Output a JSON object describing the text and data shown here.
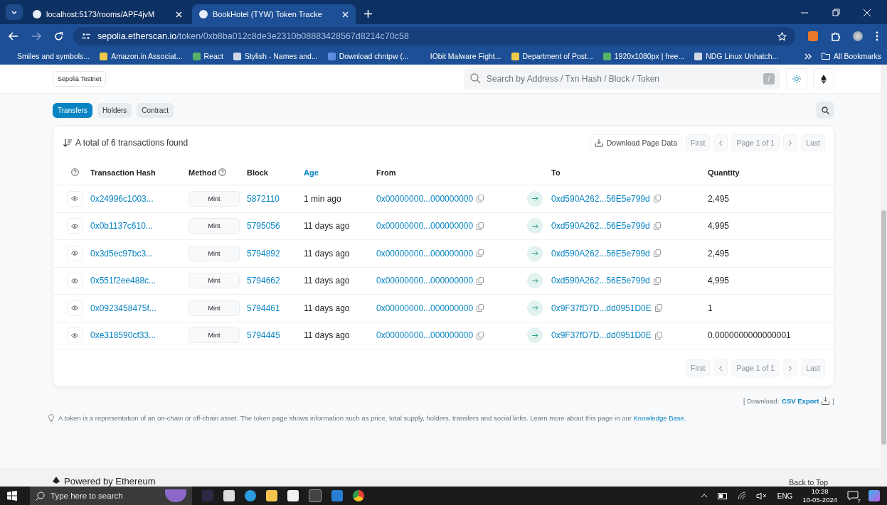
{
  "browser": {
    "tabs": [
      {
        "title": "localhost:5173/rooms/APF4jvM",
        "selected": false
      },
      {
        "title": "BookHotel (TYW) Token Tracke",
        "selected": true
      }
    ],
    "url": {
      "host": "sepolia.etherscan.io",
      "path": "/token/0xb8ba012c8de3e2310b08883428567d8214c70c58"
    },
    "bookmarks": [
      "Smiles and symbols...",
      "Amazon.in Associat...",
      "React",
      "Stylish - Names and...",
      "Download chntpw (...",
      "IObit Malware Fight...",
      "Department of Post...",
      "1920x1080px | free...",
      "NDG Linux Unhatch..."
    ],
    "all_bookmarks": "All Bookmarks"
  },
  "page": {
    "network": "Sepolia Testnet",
    "search_placeholder": "Search by Address / Txn Hash / Block / Token",
    "slash_key": "/",
    "tabs": [
      {
        "label": "Transfers",
        "selected": true
      },
      {
        "label": "Holders",
        "selected": false
      },
      {
        "label": "Contract",
        "selected": false
      }
    ],
    "summary": "A total of 6 transactions found",
    "download": "Download Page Data",
    "pagination": {
      "first": "First",
      "page": "Page 1 of 1",
      "last": "Last"
    },
    "pagination_bottom": {
      "first": "First",
      "page": "Page 1 of 1",
      "last": "Last"
    },
    "columns": [
      {
        "label": "Transaction Hash",
        "help": false,
        "active": false
      },
      {
        "label": "Method",
        "help": true,
        "active": false
      },
      {
        "label": "Block",
        "help": false,
        "active": false
      },
      {
        "label": "Age",
        "help": false,
        "active": true
      },
      {
        "label": "From",
        "help": false,
        "active": false
      },
      {
        "label": "To",
        "help": false,
        "active": false
      },
      {
        "label": "Quantity",
        "help": false,
        "active": false
      }
    ],
    "rows": [
      {
        "hash": "0x24996c1003...",
        "method": "Mint",
        "block": "5872110",
        "age": "1 min ago",
        "from": "0x00000000...000000000",
        "to": "0xd590A262...56E5e799d",
        "quantity": "2,495"
      },
      {
        "hash": "0x0b1137c610...",
        "method": "Mint",
        "block": "5795056",
        "age": "11 days ago",
        "from": "0x00000000...000000000",
        "to": "0xd590A262...56E5e799d",
        "quantity": "4,995"
      },
      {
        "hash": "0x3d5ec97bc3...",
        "method": "Mint",
        "block": "5794892",
        "age": "11 days ago",
        "from": "0x00000000...000000000",
        "to": "0xd590A262...56E5e799d",
        "quantity": "2,495"
      },
      {
        "hash": "0x551f2ee488c...",
        "method": "Mint",
        "block": "5794662",
        "age": "11 days ago",
        "from": "0x00000000...000000000",
        "to": "0xd590A262...56E5e799d",
        "quantity": "4,995"
      },
      {
        "hash": "0x0923458475f...",
        "method": "Mint",
        "block": "5794461",
        "age": "11 days ago",
        "from": "0x00000000...000000000",
        "to": "0x9F37fD7D...dd0951D0E",
        "quantity": "1"
      },
      {
        "hash": "0xe318590cf33...",
        "method": "Mint",
        "block": "5794445",
        "age": "11 days ago",
        "from": "0x00000000...000000000",
        "to": "0x9F37fD7D...dd0951D0E",
        "quantity": "0.0000000000000001"
      }
    ],
    "csv": {
      "prefix": "[ Download:",
      "link": "CSV Export",
      "suffix": "]"
    },
    "info": {
      "text": "A token is a representation of an on-chain or off-chain asset. The token page shows information such as price, total supply, holders, transfers and social links. Learn more about this page in our",
      "link": "Knowledge Base",
      "end": "."
    },
    "footer": {
      "powered": "Powered by Ethereum",
      "back_to_top": "Back to Top"
    }
  },
  "taskbar": {
    "search_placeholder": "Type here to search",
    "language": "ENG",
    "time": "10:28",
    "date": "10-05-2024",
    "notifications": "7"
  }
}
